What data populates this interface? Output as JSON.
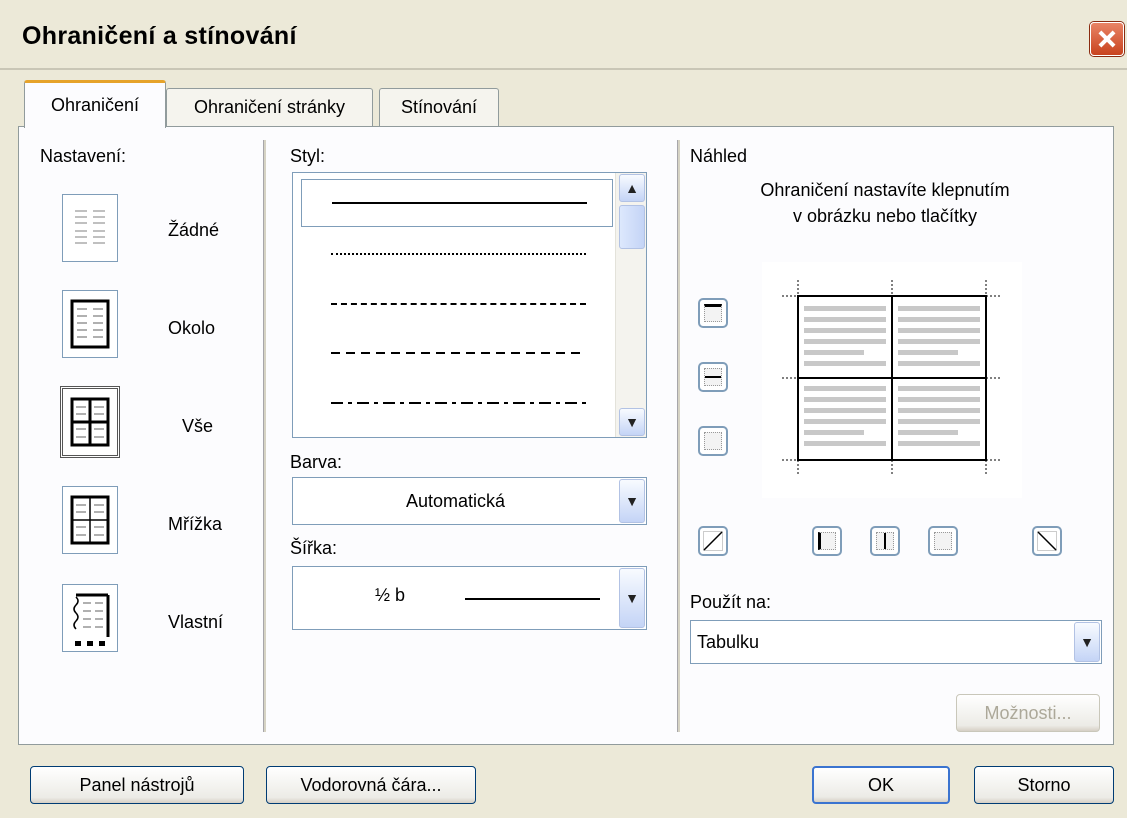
{
  "window": {
    "title": "Ohraničení a stínování"
  },
  "tabs": [
    {
      "label": "Ohraničení",
      "active": true
    },
    {
      "label": "Ohraničení stránky",
      "active": false
    },
    {
      "label": "Stínování",
      "active": false
    }
  ],
  "settings": {
    "heading": "Nastavení:",
    "items": [
      {
        "label": "Žádné",
        "icon": "border-none-icon"
      },
      {
        "label": "Okolo",
        "icon": "border-box-icon"
      },
      {
        "label": "Vše",
        "icon": "border-all-icon",
        "selected": true
      },
      {
        "label": "Mřížka",
        "icon": "border-grid-icon"
      },
      {
        "label": "Vlastní",
        "icon": "border-custom-icon"
      }
    ]
  },
  "style": {
    "heading": "Styl:",
    "items": [
      "solid",
      "dotted",
      "dashed-fine",
      "dashed",
      "dash-dot"
    ],
    "selected_index": 0
  },
  "color": {
    "label": "Barva:",
    "value": "Automatická"
  },
  "width": {
    "label": "Šířka:",
    "value": "½ b"
  },
  "preview": {
    "heading": "Náhled",
    "hint_line1": "Ohraničení nastavíte klepnutím",
    "hint_line2": "v obrázku nebo tlačítky"
  },
  "apply_to": {
    "label": "Použít na:",
    "value": "Tabulku"
  },
  "buttons": {
    "options": "Možnosti...",
    "toolbar": "Panel nástrojů",
    "horizontal_line": "Vodorovná čára...",
    "ok": "OK",
    "cancel": "Storno"
  },
  "colors": {
    "tab_accent": "#e6a32a",
    "frame_border": "#7f9db9",
    "window_bg": "#ece9d8"
  }
}
